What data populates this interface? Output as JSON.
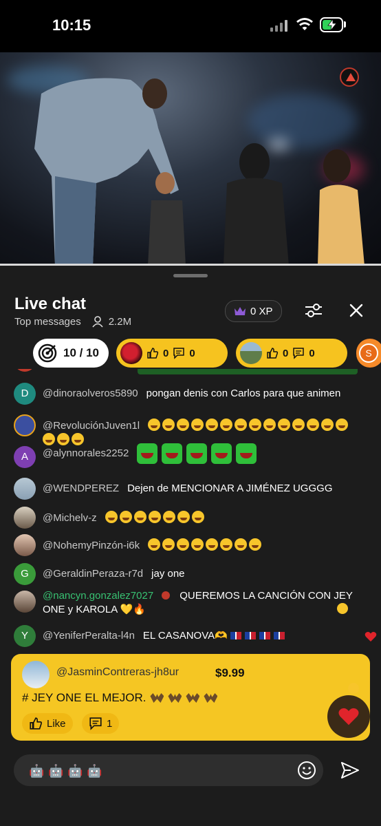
{
  "status_bar": {
    "time": "10:15",
    "battery_level": 0.55
  },
  "chat_panel": {
    "title": "Live chat",
    "filter": "Top messages",
    "viewer_count": "2.2M",
    "xp": "0 XP"
  },
  "pills": {
    "goal": "10 / 10",
    "items": [
      {
        "likes": "0",
        "comments": "0"
      },
      {
        "likes": "0",
        "comments": "0"
      }
    ],
    "avatar_letter": "S"
  },
  "messages": [
    {
      "user": "@dinoraolveros5890",
      "avatar_letter": "D",
      "avatar_color": "#1f8a7f",
      "text": "pongan denis con Carlos para que animen"
    },
    {
      "user": "@RevoluciónJuven1l",
      "text": "",
      "emoji_count": 17
    },
    {
      "user": "@alynnorales2252",
      "avatar_letter": "A",
      "avatar_color": "#7e3fb2",
      "text": "",
      "sticker_count": 5
    },
    {
      "user": "@WENDPEREZ",
      "text": "Dejen de MENCIONAR A JIMÉNEZ UGGGG"
    },
    {
      "user": "@Michelv-z",
      "text": "",
      "emoji_count": 7
    },
    {
      "user": "@NohemyPinzón-i6k",
      "text": "",
      "emoji_count": 8
    },
    {
      "user": "@GeraldinPeraza-r7d",
      "avatar_letter": "G",
      "avatar_color": "#3a9b3a",
      "text": "jay one"
    },
    {
      "user": "@nancyn.gonzalez7027",
      "text": "QUEREMOS LA CANCIÓN CON JEY ONE y KAROLA 💛🔥"
    },
    {
      "user": "@YeniferPeralta-l4n",
      "avatar_letter": "Y",
      "avatar_color": "#2f7d3a",
      "text": "EL CASANOVA🫶",
      "flag_count": 4
    }
  ],
  "pinned": {
    "user": "@JasminContreras-jh8ur",
    "amount": "$9.99",
    "message": "# JEY ONE EL MEJOR.",
    "like_label": "Like",
    "comment_count": "1"
  },
  "input": {
    "value": "🤖 🤖 🤖 🤖"
  },
  "colors": {
    "accent": "#f5c623",
    "panel": "#1c1c1c",
    "heart": "#e0242b"
  }
}
